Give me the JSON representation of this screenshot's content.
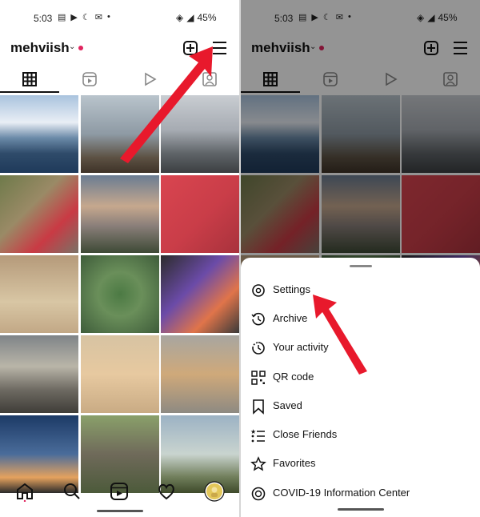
{
  "status": {
    "time": "5:03",
    "battery": "45%"
  },
  "profile": {
    "username": "mehviish"
  },
  "tabs": [
    "grid-icon",
    "reels-icon",
    "videos-icon",
    "tagged-icon"
  ],
  "grid_photos": [
    "snowy mountain lake with railing",
    "orange flower on rocks by lake",
    "misty lake with birds",
    "pink flowers and red card",
    "clouds over hillside",
    "phones on red table",
    "colourful toys on floor",
    "potted succulents top view",
    "tablet home screen",
    "sunset over beach",
    "ginger cat on ground",
    "ginger cat lying on stone",
    "airplane wing at dusk",
    "tabby cat in garden",
    "rainbow over field"
  ],
  "bottom_nav": [
    "home-icon",
    "search-icon",
    "reels-icon",
    "heart-icon",
    "profile-avatar"
  ],
  "menu": {
    "items": [
      {
        "label": "Settings",
        "icon": "settings-icon"
      },
      {
        "label": "Archive",
        "icon": "archive-icon"
      },
      {
        "label": "Your activity",
        "icon": "activity-icon"
      },
      {
        "label": "QR code",
        "icon": "qr-code-icon"
      },
      {
        "label": "Saved",
        "icon": "bookmark-icon"
      },
      {
        "label": "Close Friends",
        "icon": "close-friends-icon"
      },
      {
        "label": "Favorites",
        "icon": "star-icon"
      },
      {
        "label": "COVID-19 Information Center",
        "icon": "covid-info-icon"
      }
    ]
  },
  "colors": {
    "accent_red": "#e8192c",
    "notification_dot": "#e0245e"
  }
}
